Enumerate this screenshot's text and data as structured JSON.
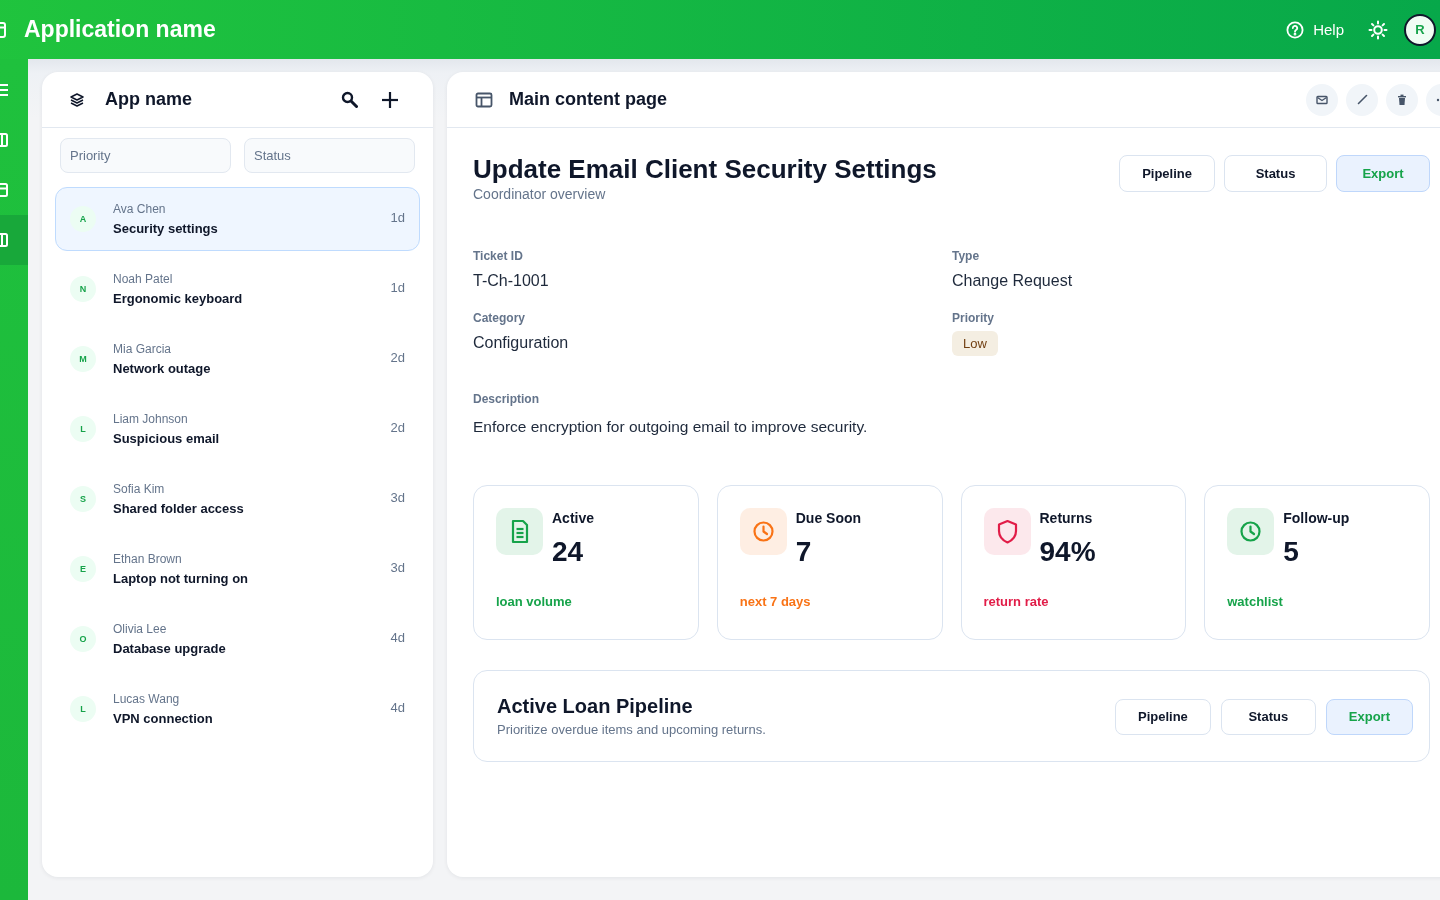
{
  "top_bar": {
    "title": "Application name",
    "help": "Help",
    "avatar": "R"
  },
  "nav_rail": {
    "items": [
      {
        "selected": false
      },
      {
        "selected": false
      },
      {
        "selected": true
      }
    ]
  },
  "list_panel": {
    "title": "App name",
    "filters": [
      {
        "placeholder": "Priority"
      },
      {
        "placeholder": "Status"
      }
    ],
    "items": [
      {
        "initial": "A",
        "name": "Ava Chen",
        "title": "Security settings",
        "age": "1d",
        "selected": true
      },
      {
        "initial": "N",
        "name": "Noah Patel",
        "title": "Ergonomic keyboard",
        "age": "1d",
        "selected": false
      },
      {
        "initial": "M",
        "name": "Mia Garcia",
        "title": "Network outage",
        "age": "2d",
        "selected": false
      },
      {
        "initial": "L",
        "name": "Liam Johnson",
        "title": "Suspicious email",
        "age": "2d",
        "selected": false
      },
      {
        "initial": "S",
        "name": "Sofia Kim",
        "title": "Shared folder access",
        "age": "3d",
        "selected": false
      },
      {
        "initial": "E",
        "name": "Ethan Brown",
        "title": "Laptop not turning on",
        "age": "3d",
        "selected": false
      },
      {
        "initial": "O",
        "name": "Olivia Lee",
        "title": "Database upgrade",
        "age": "4d",
        "selected": false
      },
      {
        "initial": "L",
        "name": "Lucas Wang",
        "title": "VPN connection",
        "age": "4d",
        "selected": false
      }
    ]
  },
  "main_panel": {
    "title": "Main content page",
    "record": {
      "title": "Update Email Client Security Settings",
      "subtitle": "Coordinator overview",
      "actions": [
        {
          "label": "Pipeline",
          "kind": "secondary"
        },
        {
          "label": "Status",
          "kind": "secondary"
        },
        {
          "label": "Export",
          "kind": "primary"
        }
      ],
      "fields": [
        {
          "label": "Ticket ID",
          "value": "T-Ch-1001",
          "kind": "text"
        },
        {
          "label": "Type",
          "value": "Change Request",
          "kind": "text"
        },
        {
          "label": "Category",
          "value": "Configuration",
          "kind": "text"
        },
        {
          "label": "Priority",
          "value": "Low",
          "kind": "badge"
        }
      ],
      "description": {
        "label": "Description",
        "value": "Enforce encryption for outgoing email to improve security."
      }
    },
    "stats": [
      {
        "label": "Active",
        "value": "24",
        "note": "loan volume",
        "color": "#16a34a"
      },
      {
        "label": "Due Soon",
        "value": "7",
        "note": "next 7 days",
        "color": "#f97316"
      },
      {
        "label": "Returns",
        "value": "94%",
        "note": "return rate",
        "color": "#e11d48"
      },
      {
        "label": "Follow-up",
        "value": "5",
        "note": "watchlist",
        "color": "#16a34a"
      }
    ],
    "pipeline": {
      "title": "Active Loan Pipeline",
      "subtitle": "Prioritize overdue items and upcoming returns.",
      "actions": [
        {
          "label": "Pipeline",
          "kind": "secondary"
        },
        {
          "label": "Status",
          "kind": "secondary"
        },
        {
          "label": "Export",
          "kind": "primary"
        }
      ]
    }
  }
}
